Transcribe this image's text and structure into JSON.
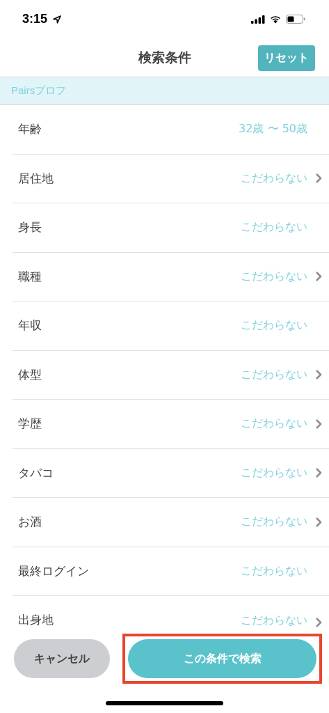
{
  "status_bar": {
    "time": "3:15"
  },
  "nav": {
    "title": "検索条件",
    "reset_button": "リセット"
  },
  "section": {
    "title": "Pairsプロフ"
  },
  "rows": [
    {
      "label": "年齢",
      "value": "32歳 〜 50歳",
      "chevron": false
    },
    {
      "label": "居住地",
      "value": "こだわらない",
      "chevron": true
    },
    {
      "label": "身長",
      "value": "こだわらない",
      "chevron": false
    },
    {
      "label": "職種",
      "value": "こだわらない",
      "chevron": true
    },
    {
      "label": "年収",
      "value": "こだわらない",
      "chevron": false
    },
    {
      "label": "体型",
      "value": "こだわらない",
      "chevron": true
    },
    {
      "label": "学歴",
      "value": "こだわらない",
      "chevron": true
    },
    {
      "label": "タバコ",
      "value": "こだわらない",
      "chevron": true
    },
    {
      "label": "お酒",
      "value": "こだわらない",
      "chevron": true
    },
    {
      "label": "最終ログイン",
      "value": "こだわらない",
      "chevron": false
    },
    {
      "label": "出身地",
      "value": "こだわらない",
      "chevron": true
    }
  ],
  "buttons": {
    "cancel": "キャンセル",
    "search": "この条件で検索",
    "search_highlighted": true
  }
}
